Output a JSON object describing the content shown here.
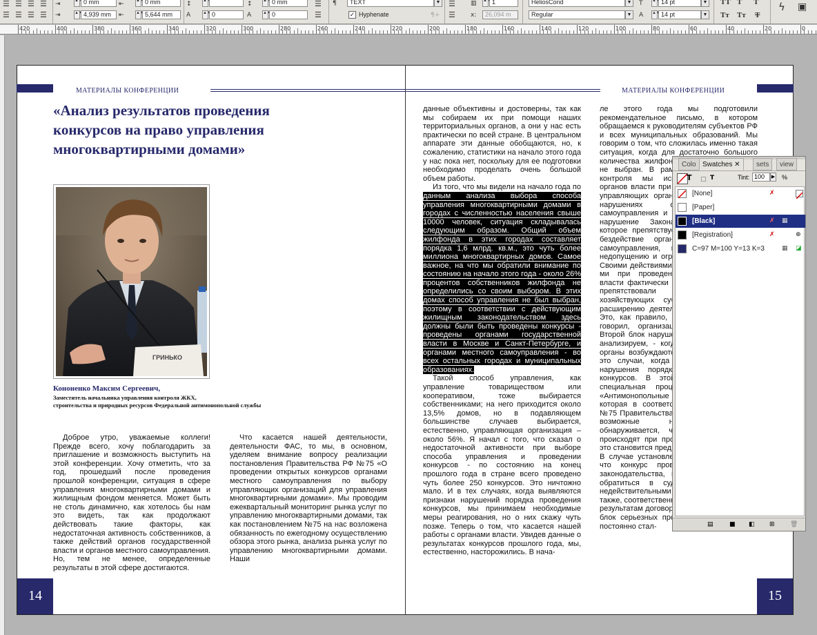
{
  "toolbar": {
    "fields": [
      "0 mm",
      "0 mm",
      "4,939 mm",
      "5,644 mm",
      "0",
      "0",
      "0 mm",
      "0",
      "1",
      "26,094 m"
    ],
    "paragraph_style": "TEXT",
    "hyphenate_label": "Hyphenate",
    "font_family": "HeliosCond",
    "font_style": "Regular",
    "font_size": "14 pt",
    "leading": "14 pt",
    "icon_labels": [
      "Tт",
      "Tт",
      "T"
    ]
  },
  "ruler": {
    "labels": [
      "420",
      "400",
      "380",
      "360",
      "340",
      "320",
      "300",
      "280",
      "260",
      "240",
      "220",
      "200",
      "180",
      "160",
      "140",
      "120",
      "100",
      "80",
      "60",
      "40",
      "20",
      "0"
    ]
  },
  "left_page": {
    "running_head": "МАТЕРИАЛЫ КОНФЕРЕНЦИИ",
    "title_lines": [
      "«Анализ результатов проведения",
      "конкурсов на право управления",
      "многоквартирными домами»"
    ],
    "nameplate_text": "ГРИНЬКО",
    "caption_name": "Кононенко Максим Сергеевич,",
    "caption_lines": [
      "Заместитель начальника управления контроля ЖКХ,",
      "строительства и природных ресурсов Федеральной антимонопольной службы"
    ],
    "col1_text": "Доброе утро, уважаемые коллеги! Прежде всего, хочу поблагодарить за приглашение и возможность выступить на этой конференции. Хочу отметить, что за год, прошедший после проведения прошлой конференции, ситуация в сфере управления многоквартирными домами и жилищным фондом меняется. Может быть не столь динамично, как хотелось бы нам это видеть, так как продолжают действовать такие факторы, как недостаточная активность собственников, а также действий органов государственной власти и органов местного самоуправления. Но, тем не менее, определенные результаты в этой сфере достигаются.",
    "col2_text": "Что касается нашей деятельности, деятельности ФАС, то мы, в основном, уделяем внимание вопросу реализации постановления Правительства РФ №75 «О проведении открытых конкурсов органами местного самоуправления по выбору управляющих организаций для управления многоквартирными домами». Мы проводим ежеквартальный мониторинг рынка услуг по управлению многоквартирными домами, так как постановлением №75 на нас возложена обязанность по ежегодному осуществлению обзора этого рынка, анализа рынка услуг по управлению многоквартирными домами. Наши",
    "page_number": "14"
  },
  "right_page": {
    "running_head": "МАТЕРИАЛЫ КОНФЕРЕНЦИИ",
    "col1_intro": "данные объективны и достоверны, так как мы собираем их при помощи наших территориальных органов, а они у нас есть практически по всей стране. В центральном аппарате эти данные обобщаются, но, к сожалению, статистики на начало этого года у нас пока нет, поскольку для ее подготовки необходимо проделать очень большой объем работы.",
    "col1_p2_plain": "Из того, что мы видели на начало года по",
    "col1_p2_selected": "данным анализа выбора способа управления многоквартирными домами в городах с численностью населения свыше 10000 человек, ситуация складывалась следующим образом. Общий объем жилфонда в этих городах составляет порядка 1,6 млрд. кв.м., это чуть более миллиона многоквартирных домов. Самое важное, на что мы обратили внимание по состоянию на начало этого года - около 26% процентов собственников жилфонда не определились со своим выбором. В этих домах способ управления не был выбран, поэтому в соответствии с действующим жилищным законодательством здесь должны были быть проведены конкурсы - проведены органами государственной власти в Москве и Санкт-Петербурге, и органами местного самоуправления - во всех остальных городах и муниципальных образованиях.",
    "col1_rest": "Такой способ управления, как управление товариществом или кооперативом, тоже выбирается собственниками; на него приходится около 13,5% домов, но в подавляющем большинстве случаев выбирается, естественно, управляющая организация – около 56%. Я начал с того, что сказал о недостаточной активности при выборе способа управления и проведении конкурсов - по состоянию на конец прошлого года в стране всего проведено чуть более 250 конкурсов. Это ничтожно мало. И в тех случаях, когда выявляются признаки нарушений порядка проведения конкурсов, мы принимаем необходимые меры реагирования, но о них скажу чуть позже. Теперь о том, что касается нашей работы с органами власти. Увидев данные о результатах конкурсов прошлого года, мы, естественно, насторожились. В нача-",
    "col2_text": "ле этого года мы подготовили рекомендательное письмо, в котором обращаемся к руководителям субъектов РФ и всех муниципальных образований. Мы говорим о том, что сложилась именно такая ситуация, когда для достаточно большого количества жилфонда способ управления не выбран. В рамках антимонопольного контроля мы используем полномочия органов власти при проведении по выбору управляющих организаций мы говорим о нарушениях органов местного самоуправления и оцениваем как прямое нарушение Закона «О конкуренции», которое препятствует действиям, а также бездействие органов власти местного самоуправления, которые приводят к недопущению и ограничению конкуренции. Своими действиями мы добиваемся, чтобы ми при проведении конкурсов органы власти фактически стали создавать рынку, препятствовали появлению новых хозяйствующих субъектов, а также и расширению деятельности существующих. Это, как правило, решений, о котором я говорил, организации самих конкурсов. Второй блок нарушений, который мы тоже анализируем, - когда в антимонопольные органы возбуждаются дела о нарушениях, это случаи, когда выявляются признаки нарушения порядка проведения самих конкурсов. В этой связи рассмотрена специальная процедура - статья 17 «Антимонопольные требования к торгам», которая в соответствии с постановления №75 Правительства РФ зом описывает все возможные нарушения. Если обнаруживается, что такие нарушения происходят при проведении конкурсов, то это становится предметом разбирательства. В случае установления нарушения о том, что конкурс проведен с нарушением законодательства, полномочия позволяют обратиться в суд, который признает недействительными результаты конкурса, а также, соответственно, и заключенные по их результатам договоры. Есть здесь еще один блок серьезных проблем, с которыми мы постоянно стал-",
    "page_number": "15"
  },
  "swatches_panel": {
    "tabs": [
      "Colo",
      "Swatches",
      "sets",
      "view"
    ],
    "tint_label": "Tint:",
    "tint_value": "100",
    "tint_unit": "%",
    "items": [
      {
        "name": "[None]",
        "color": "#ffffff"
      },
      {
        "name": "[Paper]",
        "color": "#ffffff"
      },
      {
        "name": "[Black]",
        "color": "#000000"
      },
      {
        "name": "[Registration]",
        "color": "#000000"
      },
      {
        "name": "C=97 M=100 Y=13 K=3",
        "color": "#27296b"
      }
    ]
  },
  "colors": {
    "navy": "#27296b",
    "selection": "#1f2f83"
  }
}
